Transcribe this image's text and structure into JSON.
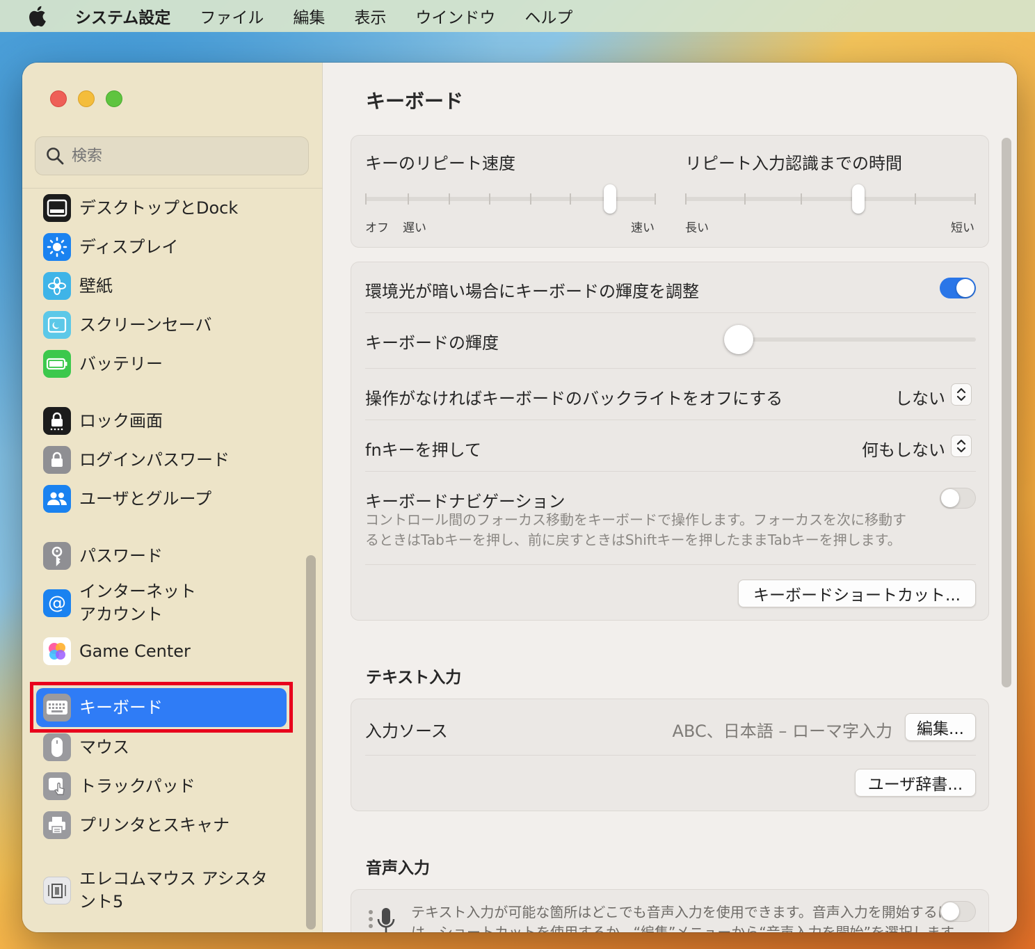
{
  "menubar": {
    "app_name": "システム設定",
    "items": [
      "ファイル",
      "編集",
      "表示",
      "ウインドウ",
      "ヘルプ"
    ]
  },
  "search": {
    "placeholder": "検索"
  },
  "sidebar": {
    "items": [
      {
        "label": "デスクトップとDock",
        "icon": "dock-icon"
      },
      {
        "label": "ディスプレイ",
        "icon": "display-icon"
      },
      {
        "label": "壁紙",
        "icon": "wallpaper-icon"
      },
      {
        "label": "スクリーンセーバ",
        "icon": "screensaver-icon"
      },
      {
        "label": "バッテリー",
        "icon": "battery-icon"
      },
      {
        "label": "ロック画面",
        "icon": "lock-screen-icon"
      },
      {
        "label": "ログインパスワード",
        "icon": "lock-icon"
      },
      {
        "label": "ユーザとグループ",
        "icon": "users-icon"
      },
      {
        "label": "パスワード",
        "icon": "key-icon"
      },
      {
        "label": "インターネット\nアカウント",
        "icon": "at-icon"
      },
      {
        "label": "Game Center",
        "icon": "game-center-icon"
      },
      {
        "label": "キーボード",
        "icon": "keyboard-icon",
        "selected": true
      },
      {
        "label": "マウス",
        "icon": "mouse-icon"
      },
      {
        "label": "トラックパッド",
        "icon": "trackpad-icon"
      },
      {
        "label": "プリンタとスキャナ",
        "icon": "printer-icon"
      },
      {
        "label": "エレコムマウス アシスタ\nント5",
        "icon": "elecom-icon"
      }
    ]
  },
  "main": {
    "title": "キーボード",
    "repeat": {
      "key_repeat_label": "キーのリピート速度",
      "key_repeat_ticks": [
        "オフ",
        "遅い",
        "速い"
      ],
      "key_repeat_value": 0.875,
      "delay_label": "リピート入力認識までの時間",
      "delay_ticks": [
        "長い",
        "短い"
      ],
      "delay_value": 0.6
    },
    "backlight": {
      "adjust_label": "環境光が暗い場合にキーボードの輝度を調整",
      "adjust_on": true,
      "brightness_label": "キーボードの輝度",
      "brightness_value": 0.0,
      "off_label": "操作がなければキーボードのバックライトをオフにする",
      "off_value": "しない",
      "fn_label": "fnキーを押して",
      "fn_value": "何もしない",
      "nav_label": "キーボードナビゲーション",
      "nav_on": false,
      "nav_desc_1": "コントロール間のフォーカス移動をキーボードで操作します。フォーカスを次に移動す",
      "nav_desc_2": "るときはTabキーを押し、前に戻すときはShiftキーを押したままTabキーを押します。",
      "shortcuts_button": "キーボードショートカット..."
    },
    "text_input": {
      "section_title": "テキスト入力",
      "source_label": "入力ソース",
      "source_value": "ABC、日本語 – ローマ字入力",
      "edit_button": "編集...",
      "dict_button": "ユーザ辞書..."
    },
    "dictation": {
      "section_title": "音声入力",
      "desc_1": "テキスト入力が可能な箇所はどこでも音声入力を使用できます。音声入力を開始するに",
      "desc_2": "は、ショートカットを使用するか、“編集”メニューから“音声入力を開始”を選択します。",
      "enabled": false
    }
  },
  "colors": {
    "accent": "#2f7cf6",
    "highlight_box": "#e8001c",
    "toggle_on": "#2a76e8"
  }
}
